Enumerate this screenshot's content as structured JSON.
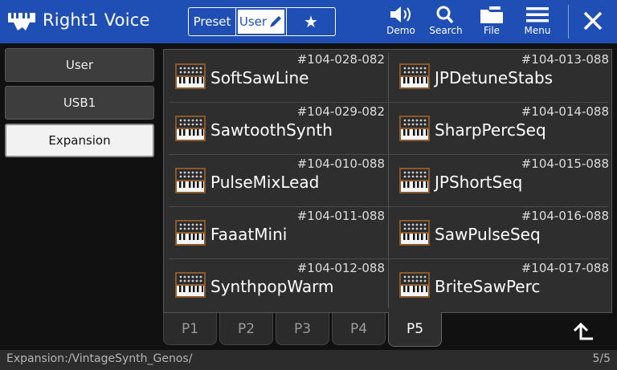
{
  "header": {
    "title": "Right1 Voice",
    "title_icon": "keyboard-hand-icon",
    "tabs": {
      "preset": "Preset",
      "user": "User",
      "favorite": "★"
    },
    "buttons": [
      {
        "label": "Demo",
        "icon": "speaker-icon"
      },
      {
        "label": "Search",
        "icon": "search-icon"
      },
      {
        "label": "File",
        "icon": "folder-icon"
      },
      {
        "label": "Menu",
        "icon": "menu-icon"
      }
    ],
    "close_icon": "close-icon",
    "accent_color": "#1f4fb4"
  },
  "sidebar": {
    "items": [
      {
        "label": "User"
      },
      {
        "label": "USB1"
      },
      {
        "label": "Expansion",
        "selected": true
      }
    ]
  },
  "voices": [
    {
      "number": "#104-028-082",
      "name": "SoftSawLine"
    },
    {
      "number": "#104-013-088",
      "name": "JPDetuneStabs"
    },
    {
      "number": "#104-029-082",
      "name": "SawtoothSynth"
    },
    {
      "number": "#104-014-088",
      "name": "SharpPercSeq"
    },
    {
      "number": "#104-010-088",
      "name": "PulseMixLead"
    },
    {
      "number": "#104-015-088",
      "name": "JPShortSeq"
    },
    {
      "number": "#104-011-088",
      "name": "FaaatMini"
    },
    {
      "number": "#104-016-088",
      "name": "SawPulseSeq"
    },
    {
      "number": "#104-012-088",
      "name": "SynthpopWarm"
    },
    {
      "number": "#104-017-088",
      "name": "BriteSawPerc"
    }
  ],
  "pages": {
    "tabs": [
      "P1",
      "P2",
      "P3",
      "P4",
      "P5"
    ],
    "active": "P5",
    "up_icon": "up-arrow-icon"
  },
  "status": {
    "path": "Expansion:/VintageSynth_Genos/",
    "page_count": "5/5"
  }
}
